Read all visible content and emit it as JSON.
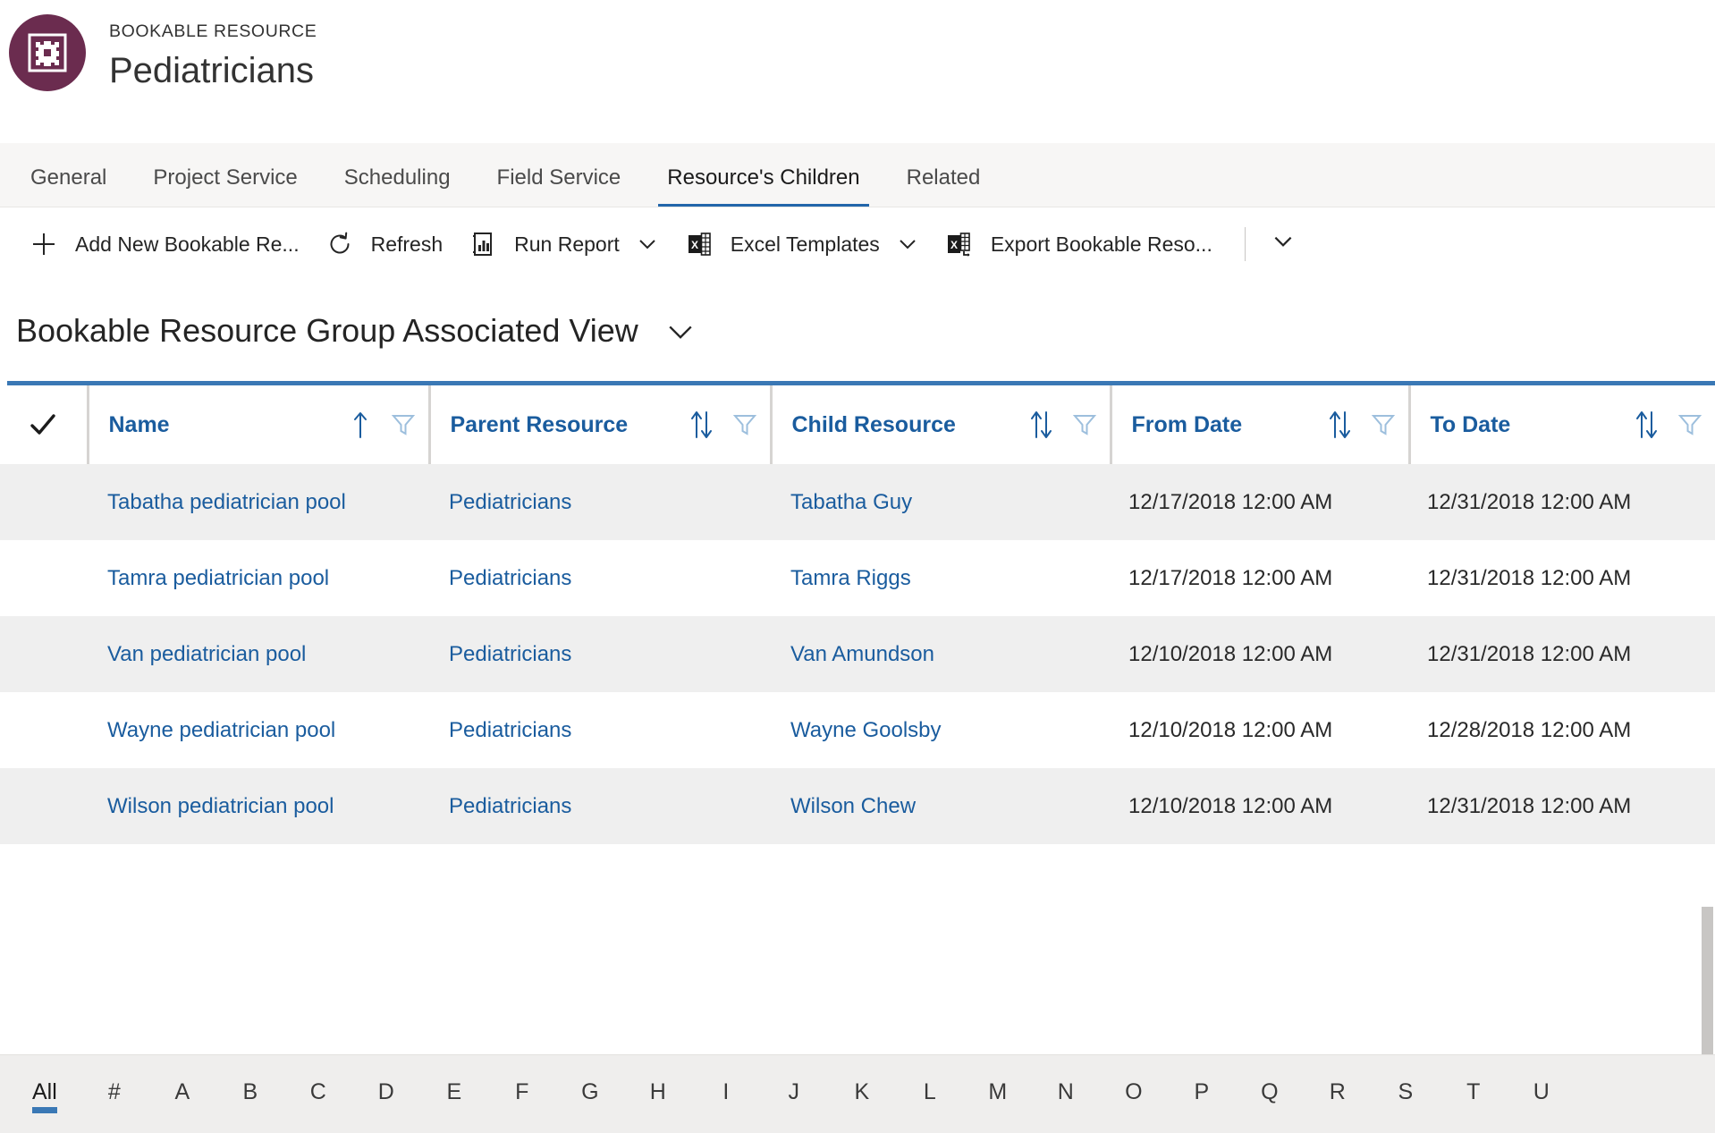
{
  "header": {
    "entity_type": "BOOKABLE RESOURCE",
    "record_name": "Pediatricians",
    "avatar_icon": "bookable-resource-icon",
    "avatar_color": "#6b2c4f"
  },
  "tabs": [
    {
      "label": "General",
      "active": false
    },
    {
      "label": "Project Service",
      "active": false
    },
    {
      "label": "Scheduling",
      "active": false
    },
    {
      "label": "Field Service",
      "active": false
    },
    {
      "label": "Resource's Children",
      "active": true
    },
    {
      "label": "Related",
      "active": false
    }
  ],
  "commandbar": {
    "items": [
      {
        "label": "Add New Bookable Re...",
        "icon": "plus-icon",
        "caret": false
      },
      {
        "label": "Refresh",
        "icon": "refresh-icon",
        "caret": false
      },
      {
        "label": "Run Report",
        "icon": "report-icon",
        "caret": true
      },
      {
        "label": "Excel Templates",
        "icon": "excel-icon",
        "caret": true
      },
      {
        "label": "Export Bookable Reso...",
        "icon": "excel-export-icon",
        "caret": false
      }
    ],
    "overflow_icon": "chevron-down-icon"
  },
  "view": {
    "title": "Bookable Resource Group Associated View",
    "caret_icon": "chevron-down-icon"
  },
  "grid": {
    "accent_color": "#3a78b5",
    "link_color": "#1a5c9e",
    "select_all_icon": "checkmark-icon",
    "columns": [
      {
        "label": "Name",
        "sort": "asc",
        "sort_icon": "sort-asc-icon",
        "filter_icon": "filter-icon"
      },
      {
        "label": "Parent Resource",
        "sort": "none",
        "sort_icon": "sort-both-icon",
        "filter_icon": "filter-icon"
      },
      {
        "label": "Child Resource",
        "sort": "none",
        "sort_icon": "sort-both-icon",
        "filter_icon": "filter-icon"
      },
      {
        "label": "From Date",
        "sort": "none",
        "sort_icon": "sort-both-icon",
        "filter_icon": "filter-icon"
      },
      {
        "label": "To Date",
        "sort": "none",
        "sort_icon": "sort-both-icon",
        "filter_icon": "filter-icon"
      }
    ],
    "rows": [
      {
        "name": "Tabatha pediatrician pool",
        "parent_resource": "Pediatricians",
        "child_resource": "Tabatha Guy",
        "from_date": "12/17/2018 12:00 AM",
        "to_date": "12/31/2018 12:00 AM"
      },
      {
        "name": "Tamra pediatrician pool",
        "parent_resource": "Pediatricians",
        "child_resource": "Tamra Riggs",
        "from_date": "12/17/2018 12:00 AM",
        "to_date": "12/31/2018 12:00 AM"
      },
      {
        "name": "Van pediatrician pool",
        "parent_resource": "Pediatricians",
        "child_resource": "Van Amundson",
        "from_date": "12/10/2018 12:00 AM",
        "to_date": "12/31/2018 12:00 AM"
      },
      {
        "name": "Wayne pediatrician pool",
        "parent_resource": "Pediatricians",
        "child_resource": "Wayne Goolsby",
        "from_date": "12/10/2018 12:00 AM",
        "to_date": "12/28/2018 12:00 AM"
      },
      {
        "name": "Wilson pediatrician pool",
        "parent_resource": "Pediatricians",
        "child_resource": "Wilson Chew",
        "from_date": "12/10/2018 12:00 AM",
        "to_date": "12/31/2018 12:00 AM"
      }
    ]
  },
  "alpha_filter": {
    "selected": "All",
    "items": [
      "All",
      "#",
      "A",
      "B",
      "C",
      "D",
      "E",
      "F",
      "G",
      "H",
      "I",
      "J",
      "K",
      "L",
      "M",
      "N",
      "O",
      "P",
      "Q",
      "R",
      "S",
      "T",
      "U"
    ]
  }
}
